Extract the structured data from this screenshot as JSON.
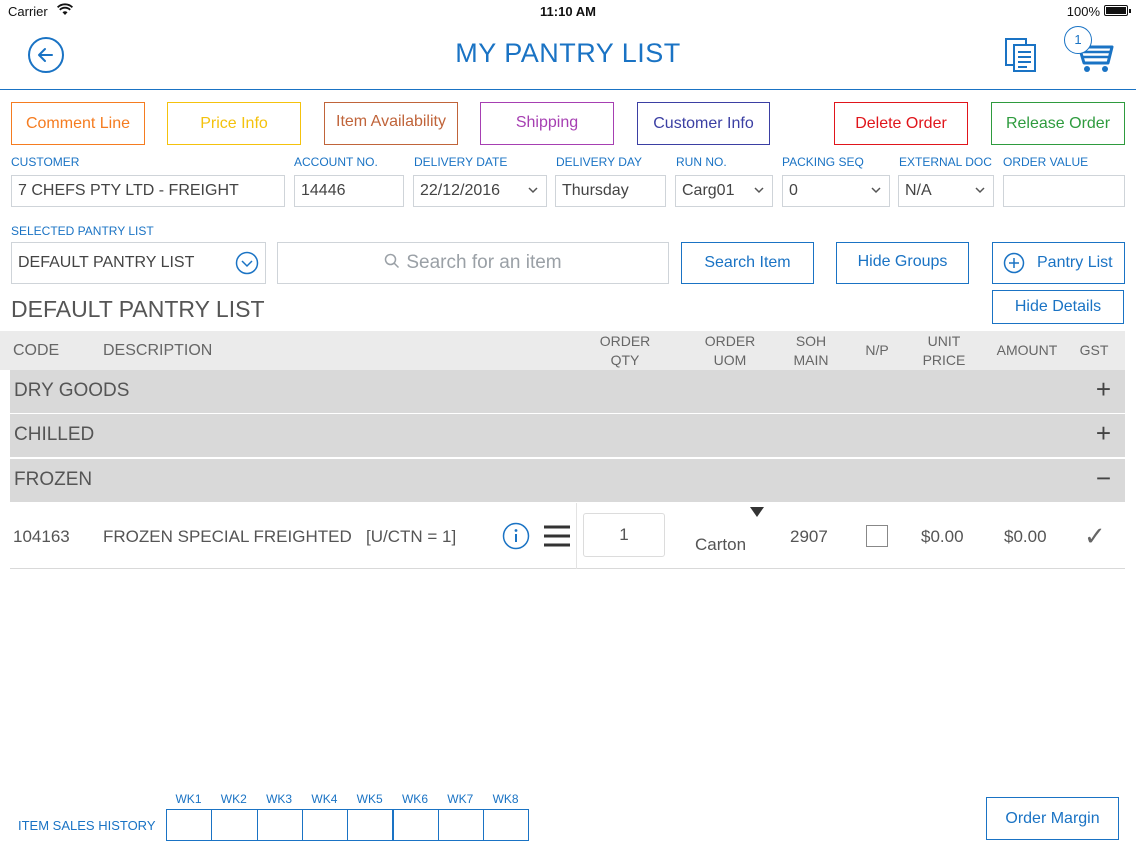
{
  "status_bar": {
    "carrier": "Carrier",
    "time": "11:10 AM",
    "battery": "100%"
  },
  "header": {
    "title": "MY PANTRY LIST",
    "cart_count": "1"
  },
  "top_buttons": [
    {
      "label": "Comment Line",
      "color": "#f57c20"
    },
    {
      "label": "Price Info",
      "color": "#f4c20d"
    },
    {
      "label": "Item Availability",
      "color": "#c0643a"
    },
    {
      "label": "Shipping",
      "color": "#a63fb2"
    },
    {
      "label": "Customer Info",
      "color": "#3b3fa3"
    },
    {
      "label": "Delete Order",
      "color": "#e0151b"
    },
    {
      "label": "Release Order",
      "color": "#2e9b3e"
    }
  ],
  "fields": {
    "customer": {
      "label": "CUSTOMER",
      "value": "7 CHEFS PTY LTD - FREIGHT"
    },
    "account_no": {
      "label": "ACCOUNT NO.",
      "value": "14446"
    },
    "delivery_date": {
      "label": "DELIVERY DATE",
      "value": "22/12/2016"
    },
    "delivery_day": {
      "label": "DELIVERY DAY",
      "value": "Thursday"
    },
    "run_no": {
      "label": "RUN NO.",
      "value": "Carg01"
    },
    "packing_seq": {
      "label": "PACKING SEQ",
      "value": "0"
    },
    "external_doc": {
      "label": "EXTERNAL DOC",
      "value": "N/A"
    },
    "order_value": {
      "label": "ORDER VALUE",
      "value": ""
    }
  },
  "pantry": {
    "selected_label": "SELECTED PANTRY LIST",
    "selected_value": "DEFAULT PANTRY LIST",
    "search_placeholder": "Search for an item",
    "search_button": "Search Item",
    "hide_groups_button": "Hide Groups",
    "pantry_list_button": "Pantry List",
    "hide_details_button": "Hide Details",
    "section_title": "DEFAULT PANTRY LIST"
  },
  "table": {
    "headers": {
      "code": "CODE",
      "description": "DESCRIPTION",
      "order_qty_1": "ORDER",
      "order_qty_2": "QTY",
      "order_uom_1": "ORDER",
      "order_uom_2": "UOM",
      "soh_1": "SOH",
      "soh_2": "MAIN",
      "np": "N/P",
      "unit_price_1": "UNIT",
      "unit_price_2": "PRICE",
      "amount": "AMOUNT",
      "gst": "GST"
    },
    "groups": [
      {
        "name": "DRY GOODS",
        "sign": "+"
      },
      {
        "name": "CHILLED",
        "sign": "+"
      },
      {
        "name": "FROZEN",
        "sign": "−"
      }
    ],
    "item": {
      "code": "104163",
      "description": "FROZEN SPECIAL FREIGHTED",
      "pack": "[U/CTN = 1]",
      "order_qty": "1",
      "uom": "Carton",
      "soh": "2907",
      "unit_price": "$0.00",
      "amount": "$0.00",
      "gst": "✓"
    }
  },
  "sales_history": {
    "label": "ITEM SALES HISTORY",
    "weeks": [
      "WK1",
      "WK2",
      "WK3",
      "WK4",
      "WK5",
      "WK6",
      "WK7",
      "WK8"
    ]
  },
  "order_margin_button": "Order Margin"
}
